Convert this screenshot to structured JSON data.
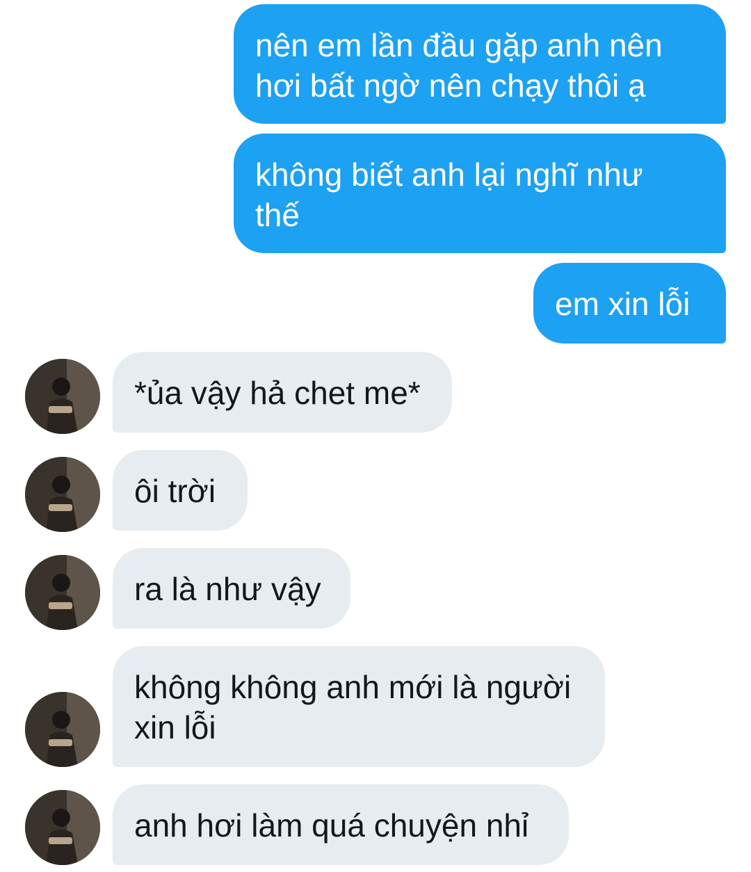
{
  "conversation": {
    "messages": [
      {
        "direction": "outgoing",
        "text": "nên em lần đầu gặp anh nên\nhơi bất ngờ nên chạy thôi ạ"
      },
      {
        "direction": "outgoing",
        "text": "không biết anh lại nghĩ như\nthế"
      },
      {
        "direction": "outgoing",
        "text": "em xin lỗi"
      },
      {
        "direction": "incoming",
        "text": "*ủa vậy hả chet me*"
      },
      {
        "direction": "incoming",
        "text": "ôi trời"
      },
      {
        "direction": "incoming",
        "text": "ra là như vậy"
      },
      {
        "direction": "incoming",
        "text": "không không anh mới là người\nxin lỗi"
      },
      {
        "direction": "incoming",
        "text": "anh hơi làm quá chuyện nhỉ"
      }
    ]
  },
  "colors": {
    "outgoing_bubble": "#1da1f2",
    "incoming_bubble": "#e6ecf0",
    "incoming_text": "#14171a",
    "outgoing_text": "#ffffff"
  },
  "icons": {
    "avatar": "sender-avatar-photo"
  }
}
